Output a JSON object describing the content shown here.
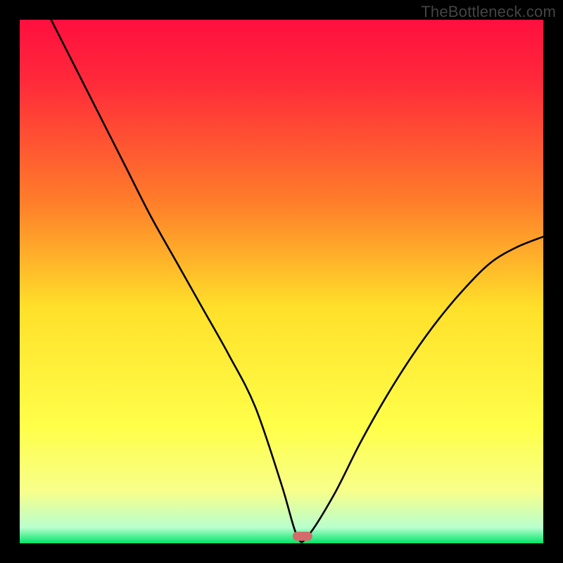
{
  "watermark": "TheBottleneck.com",
  "chart_data": {
    "type": "line",
    "title": "",
    "xlabel": "",
    "ylabel": "",
    "xlim": [
      0,
      100
    ],
    "ylim": [
      0,
      100
    ],
    "series": [
      {
        "name": "bottleneck-curve",
        "x": [
          6,
          10,
          15,
          20,
          25,
          30,
          35,
          40,
          45,
          50,
          53,
          55,
          60,
          65,
          70,
          75,
          80,
          85,
          90,
          95,
          100
        ],
        "y": [
          100,
          92,
          82,
          72,
          62,
          53,
          44,
          35,
          25,
          10,
          0,
          0,
          8,
          18,
          27,
          35,
          42,
          48,
          53,
          56,
          58
        ]
      }
    ],
    "marker": {
      "x": 54,
      "y": 0,
      "color": "#d36b6b"
    },
    "gradient_colors": {
      "top": "#ff0f3f",
      "mid_upper": "#ff7e2a",
      "mid": "#ffe02a",
      "mid_lower": "#f7ff8a",
      "bottom": "#00e56a"
    }
  }
}
